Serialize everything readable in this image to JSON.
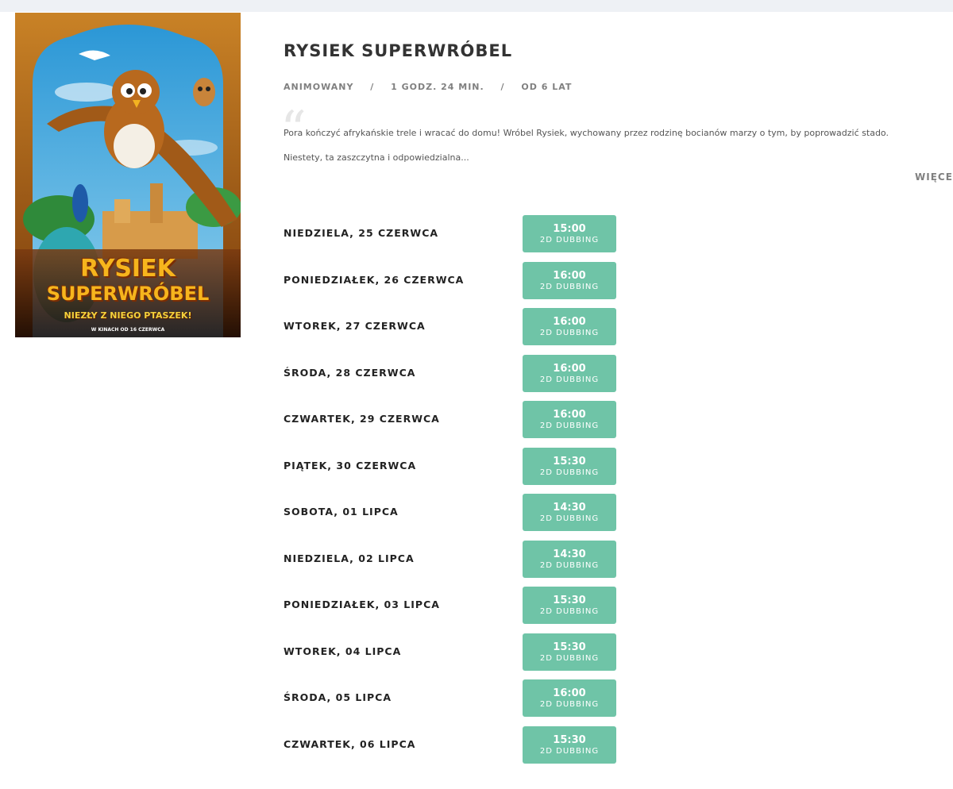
{
  "movie": {
    "title": "RYSIEK SUPERWRÓBEL",
    "genre": "ANIMOWANY",
    "duration": "1 GODZ. 24 MIN.",
    "age": "OD 6 LAT",
    "meta_separator": "/",
    "synopsis_line1": "Pora kończyć afrykańskie trele i wracać do domu! Wróbel Rysiek, wychowany przez rodzinę bocianów marzy o tym, by poprowadzić stado.",
    "synopsis_line2": "Niestety, ta zaszczytna i odpowiedzialna...",
    "more_label": "WIĘCE"
  },
  "poster": {
    "title_line1": "RYSIEK",
    "title_line2": "SUPERWRÓBEL",
    "tagline": "NIEZŁY Z NIEGO PTASZEK!",
    "release": "W KINACH OD 16 CZERWCA"
  },
  "showtimes": [
    {
      "day": "NIEDZIELA, 25 CZERWCA",
      "time": "15:00",
      "format": "2D DUBBING"
    },
    {
      "day": "PONIEDZIAŁEK, 26 CZERWCA",
      "time": "16:00",
      "format": "2D DUBBING"
    },
    {
      "day": "WTOREK, 27 CZERWCA",
      "time": "16:00",
      "format": "2D DUBBING"
    },
    {
      "day": "ŚRODA, 28 CZERWCA",
      "time": "16:00",
      "format": "2D DUBBING"
    },
    {
      "day": "CZWARTEK, 29 CZERWCA",
      "time": "16:00",
      "format": "2D DUBBING"
    },
    {
      "day": "PIĄTEK, 30 CZERWCA",
      "time": "15:30",
      "format": "2D DUBBING"
    },
    {
      "day": "SOBOTA, 01 LIPCA",
      "time": "14:30",
      "format": "2D DUBBING"
    },
    {
      "day": "NIEDZIELA, 02 LIPCA",
      "time": "14:30",
      "format": "2D DUBBING"
    },
    {
      "day": "PONIEDZIAŁEK, 03 LIPCA",
      "time": "15:30",
      "format": "2D DUBBING"
    },
    {
      "day": "WTOREK, 04 LIPCA",
      "time": "15:30",
      "format": "2D DUBBING"
    },
    {
      "day": "ŚRODA, 05 LIPCA",
      "time": "16:00",
      "format": "2D DUBBING"
    },
    {
      "day": "CZWARTEK, 06 LIPCA",
      "time": "15:30",
      "format": "2D DUBBING"
    }
  ],
  "colors": {
    "showtime_button": "#6fc4a7",
    "title_text": "#333333",
    "meta_text": "#808080"
  }
}
